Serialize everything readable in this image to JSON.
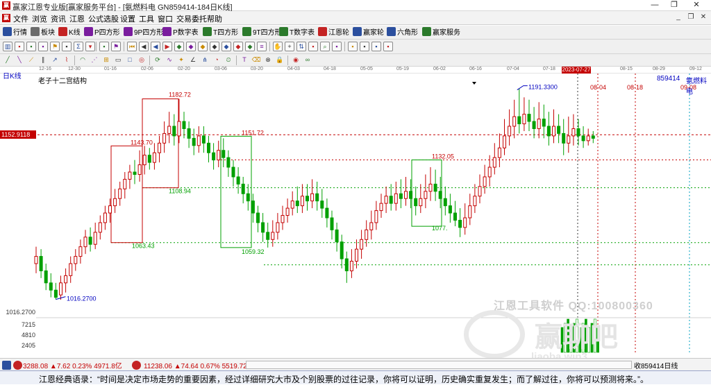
{
  "window": {
    "title": "赢家江恩专业版[赢家服务平台] - [氨燃料电 GN859414-184日K线]",
    "app_icon_text": "赢",
    "minimize": "—",
    "restore": "❐",
    "close": "✕"
  },
  "menu": {
    "items": [
      "文件",
      "浏览",
      "资讯",
      "江恩",
      "公式选股",
      "设置",
      "工具",
      "窗口",
      "交易委托",
      "帮助"
    ],
    "corner_buttons": [
      "_",
      "❐",
      "✕"
    ]
  },
  "toolbar1": {
    "buttons": [
      {
        "label": "行情",
        "color": "#2b4f9e"
      },
      {
        "label": "板块",
        "color": "#6b6b6b"
      },
      {
        "label": "K线",
        "color": "#c42323"
      },
      {
        "label": "P四方形",
        "color": "#7a1d9e"
      },
      {
        "label": "9P四方形",
        "color": "#7a1d9e"
      },
      {
        "label": "P数字表",
        "color": "#7a1d9e"
      },
      {
        "label": "T四方形",
        "color": "#2b7a2b"
      },
      {
        "label": "9T四方形",
        "color": "#2b7a2b"
      },
      {
        "label": "T数字表",
        "color": "#2b7a2b"
      },
      {
        "label": "江恩轮",
        "color": "#c42323"
      },
      {
        "label": "赢家轮",
        "color": "#2b4f9e"
      },
      {
        "label": "六角形",
        "color": "#2b4f9e"
      },
      {
        "label": "赢家服务",
        "color": "#2b7a2b"
      }
    ]
  },
  "toolbar2": {
    "icons": [
      "bars-icon",
      "grid-icon",
      "book-icon",
      "letter-a-icon",
      "flag-icon",
      "ruler-icon",
      "sigma-icon",
      "chevron-down-icon",
      "align-icon",
      "flag-red-icon",
      "first-icon",
      "prev-icon",
      "back-icon",
      "forward-icon",
      "diamond-icon",
      "diamond-icon",
      "diamond-icon",
      "diamond-icon",
      "diamond-icon",
      "diamond-icon",
      "diamond-icon",
      "lines-icon",
      "hand-icon",
      "cross-icon",
      "arrows-icon",
      "pan-icon",
      "zoom-icon",
      "image-icon",
      "calc-icon",
      "folder-icon",
      "news-icon",
      "car-icon"
    ]
  },
  "toolbar3": {
    "icons": [
      "pen-icon",
      "line-icon",
      "ray-icon",
      "parallel-icon",
      "trend-icon",
      "fibo-icon",
      "arc-icon",
      "fan-icon",
      "grid-icon",
      "box-icon",
      "square-icon",
      "spiral-icon",
      "cycle-icon",
      "wave-icon",
      "gann-icon",
      "angle-icon",
      "pitch-icon",
      "cycle2-icon",
      "time-icon",
      "text-icon",
      "eraser-icon",
      "magnet-icon",
      "lock-icon",
      "color-icon",
      "loop-icon"
    ]
  },
  "date_ruler": {
    "labels": [
      "12-16",
      "12-30",
      "01-16",
      "02-06",
      "02-20",
      "03-06",
      "03-20",
      "04-03",
      "04-18",
      "05-05",
      "05-19",
      "06-02",
      "06-16",
      "07-04",
      "07-18",
      "08-15",
      "08-29",
      "09-12"
    ],
    "highlight": "2023-07-27"
  },
  "chart_header": {
    "period": "日K线",
    "study": "老子十二宫结构",
    "code": "859414",
    "name": "氨燃料电"
  },
  "price_tag": "1152.9118",
  "y_labels": {
    "low": "1016.2700",
    "vol": [
      "7215",
      "4810",
      "2405"
    ]
  },
  "annotations": [
    {
      "text": "1182.72",
      "color": "#c40000"
    },
    {
      "text": "1143.70",
      "color": "#c40000"
    },
    {
      "text": "1108.94",
      "color": "#00a000"
    },
    {
      "text": "1063.43",
      "color": "#00a000"
    },
    {
      "text": "1151.72",
      "color": "#c40000"
    },
    {
      "text": "1059.32",
      "color": "#00a000"
    },
    {
      "text": "1132.05",
      "color": "#c40000"
    },
    {
      "text": "1077.",
      "color": "#00a000"
    },
    {
      "text": "1191.3300",
      "color": "#0000c0"
    },
    {
      "text": "1016.2700",
      "color": "#0000c0"
    }
  ],
  "future_dates": [
    "08-04",
    "08-18",
    "09-08"
  ],
  "watermark": {
    "text": "江恩工具软件  QQ:100800360",
    "big": "赢聊吧",
    "url": "liaoba.win3"
  },
  "status": {
    "index1": "3288.08 ▲7.62 0.23% 4971.8亿",
    "index2": "11238.06 ▲74.64 0.67% 5519.72亿",
    "right": "收859414日线"
  },
  "quote": "江恩经典语录：“时间是决定市场走势的重要因素，经过详细研究大市及个别股票的过往记录，你将可以证明，历史确实重复发生；而了解过往，你将可以预测将来。”。",
  "chart_data": {
    "type": "candlestick",
    "title": "老子十二宫结构",
    "ylabel": "",
    "ylim": [
      1008,
      1198
    ],
    "series": [
      {
        "values": [
          [
            1046,
            1052,
            1038,
            1060
          ],
          [
            1052,
            1040,
            1034,
            1058
          ],
          [
            1040,
            1030,
            1024,
            1046
          ],
          [
            1030,
            1024,
            1018,
            1038
          ],
          [
            1024,
            1018,
            1016.27,
            1030
          ],
          [
            1020,
            1030,
            1016,
            1036
          ],
          [
            1030,
            1036,
            1022,
            1042
          ],
          [
            1036,
            1046,
            1030,
            1052
          ],
          [
            1046,
            1052,
            1040,
            1058
          ],
          [
            1052,
            1060,
            1046,
            1066
          ],
          [
            1060,
            1068,
            1054,
            1074
          ],
          [
            1068,
            1062,
            1056,
            1076
          ],
          [
            1062,
            1072,
            1058,
            1080
          ],
          [
            1072,
            1080,
            1066,
            1086
          ],
          [
            1080,
            1088,
            1074,
            1094
          ],
          [
            1088,
            1094,
            1080,
            1100
          ],
          [
            1094,
            1100,
            1088,
            1108
          ],
          [
            1100,
            1108,
            1094,
            1114
          ],
          [
            1108,
            1116,
            1100,
            1122
          ],
          [
            1116,
            1122,
            1108,
            1128
          ],
          [
            1122,
            1120,
            1112,
            1132
          ],
          [
            1120,
            1128,
            1114,
            1140
          ],
          [
            1128,
            1136,
            1120,
            1143.7
          ],
          [
            1136,
            1130,
            1124,
            1142
          ],
          [
            1130,
            1138,
            1124,
            1146
          ],
          [
            1138,
            1146,
            1130,
            1152
          ],
          [
            1146,
            1154,
            1138,
            1164
          ],
          [
            1154,
            1160,
            1146,
            1172
          ],
          [
            1160,
            1152,
            1144,
            1170
          ],
          [
            1152,
            1164,
            1146,
            1182.72
          ],
          [
            1164,
            1158,
            1150,
            1172
          ],
          [
            1158,
            1150,
            1142,
            1164
          ],
          [
            1150,
            1144,
            1136,
            1158
          ],
          [
            1144,
            1152,
            1138,
            1160
          ],
          [
            1152,
            1146,
            1138,
            1160
          ],
          [
            1146,
            1138,
            1130,
            1152
          ],
          [
            1138,
            1132,
            1124,
            1146
          ],
          [
            1132,
            1140,
            1126,
            1148
          ],
          [
            1140,
            1134,
            1126,
            1150
          ],
          [
            1134,
            1126,
            1118,
            1140
          ],
          [
            1126,
            1118,
            1110,
            1132
          ],
          [
            1118,
            1112,
            1104,
            1126
          ],
          [
            1112,
            1104,
            1096,
            1118
          ],
          [
            1104,
            1098,
            1090,
            1112
          ],
          [
            1098,
            1088,
            1080,
            1104
          ],
          [
            1088,
            1080,
            1072,
            1094
          ],
          [
            1080,
            1072,
            1064,
            1088
          ],
          [
            1072,
            1066,
            1059.32,
            1080
          ],
          [
            1066,
            1072,
            1060,
            1082
          ],
          [
            1072,
            1080,
            1066,
            1088
          ],
          [
            1080,
            1086,
            1074,
            1094
          ],
          [
            1086,
            1092,
            1080,
            1100
          ],
          [
            1092,
            1098,
            1086,
            1106
          ],
          [
            1098,
            1094,
            1088,
            1110
          ],
          [
            1094,
            1102,
            1088,
            1112
          ],
          [
            1102,
            1098,
            1090,
            1112
          ],
          [
            1098,
            1104,
            1092,
            1116
          ],
          [
            1104,
            1098,
            1090,
            1114
          ],
          [
            1098,
            1092,
            1084,
            1108
          ],
          [
            1092,
            1084,
            1076,
            1100
          ],
          [
            1084,
            1074,
            1066,
            1090
          ],
          [
            1074,
            1064,
            1056,
            1080
          ],
          [
            1064,
            1050,
            1042,
            1070
          ],
          [
            1050,
            1040,
            1030,
            1056
          ],
          [
            1040,
            1048,
            1034,
            1058
          ],
          [
            1048,
            1058,
            1042,
            1066
          ],
          [
            1058,
            1066,
            1050,
            1074
          ],
          [
            1066,
            1074,
            1060,
            1082
          ],
          [
            1074,
            1080,
            1066,
            1090
          ],
          [
            1080,
            1090,
            1074,
            1098
          ],
          [
            1090,
            1096,
            1084,
            1104
          ],
          [
            1096,
            1102,
            1088,
            1110
          ],
          [
            1102,
            1096,
            1090,
            1112
          ],
          [
            1096,
            1104,
            1090,
            1114
          ],
          [
            1104,
            1100,
            1092,
            1116
          ],
          [
            1100,
            1106,
            1094,
            1118
          ],
          [
            1106,
            1100,
            1092,
            1116
          ],
          [
            1100,
            1094,
            1086,
            1110
          ],
          [
            1094,
            1100,
            1088,
            1112
          ],
          [
            1100,
            1106,
            1092,
            1120
          ],
          [
            1106,
            1112,
            1098,
            1126
          ],
          [
            1112,
            1106,
            1098,
            1124
          ],
          [
            1106,
            1100,
            1092,
            1118
          ],
          [
            1100,
            1094,
            1086,
            1110
          ],
          [
            1094,
            1088,
            1080,
            1104
          ],
          [
            1088,
            1082,
            1077,
            1098
          ],
          [
            1082,
            1076,
            1068,
            1092
          ],
          [
            1076,
            1084,
            1070,
            1096
          ],
          [
            1084,
            1094,
            1078,
            1104
          ],
          [
            1094,
            1102,
            1088,
            1112
          ],
          [
            1102,
            1110,
            1096,
            1120
          ],
          [
            1110,
            1118,
            1104,
            1128
          ],
          [
            1118,
            1126,
            1110,
            1136
          ],
          [
            1126,
            1134,
            1120,
            1146
          ],
          [
            1134,
            1142,
            1126,
            1154
          ],
          [
            1142,
            1152,
            1136,
            1166
          ],
          [
            1152,
            1160,
            1144,
            1174
          ],
          [
            1160,
            1168,
            1150,
            1182
          ],
          [
            1168,
            1162,
            1154,
            1191.33
          ],
          [
            1162,
            1170,
            1156,
            1184
          ],
          [
            1170,
            1164,
            1156,
            1182
          ],
          [
            1164,
            1158,
            1150,
            1176
          ],
          [
            1158,
            1166,
            1150,
            1180
          ],
          [
            1166,
            1160,
            1150,
            1178
          ],
          [
            1160,
            1152,
            1144,
            1172
          ],
          [
            1152,
            1160,
            1146,
            1174
          ],
          [
            1160,
            1154,
            1146,
            1170
          ],
          [
            1154,
            1146,
            1136,
            1166
          ],
          [
            1146,
            1152,
            1138,
            1168
          ],
          [
            1152,
            1158,
            1144,
            1170
          ],
          [
            1158,
            1152,
            1144,
            1166
          ],
          [
            1152,
            1148,
            1142,
            1160
          ],
          [
            1148,
            1152,
            1144,
            1158
          ],
          [
            1152,
            1150,
            1146,
            1156
          ]
        ]
      }
    ]
  }
}
